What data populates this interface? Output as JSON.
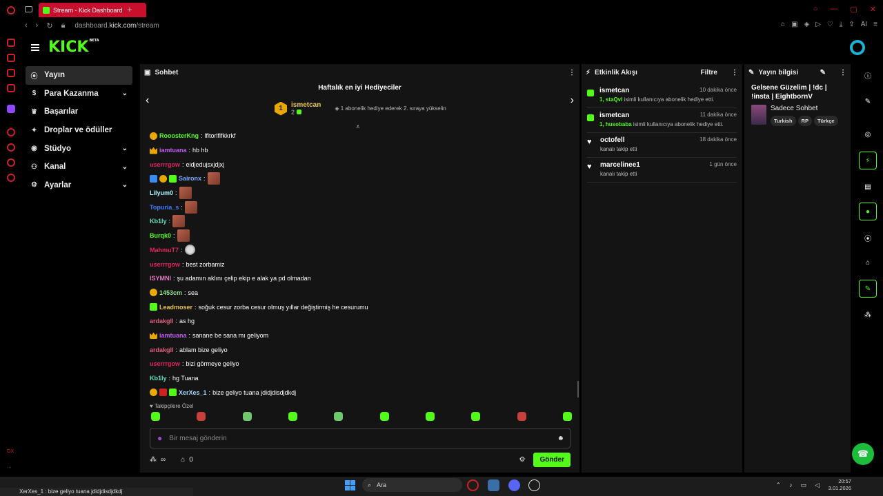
{
  "browser": {
    "tab_title": "Stream - Kick Dashboard",
    "url_prefix": "dashboard.",
    "url_host": "kick.com",
    "url_path": "/stream",
    "ai_label": "AI"
  },
  "header": {
    "logo": "KICK",
    "logo_beta": "BETA"
  },
  "nav": {
    "items": [
      {
        "label": "Yayın",
        "icon": "broadcast-icon"
      },
      {
        "label": "Para Kazanma",
        "icon": "dollar-icon"
      },
      {
        "label": "Başarılar",
        "icon": "trophy-icon"
      },
      {
        "label": "Droplar ve ödüller",
        "icon": "gift-icon"
      },
      {
        "label": "Stüdyo",
        "icon": "studio-icon"
      },
      {
        "label": "Kanal",
        "icon": "people-icon"
      },
      {
        "label": "Ayarlar",
        "icon": "gear-icon"
      }
    ],
    "gx": "GX",
    "more": "..."
  },
  "chat": {
    "title": "Sohbet",
    "gifters_title": "Haftalık en iyi Hediyeciler",
    "top_gifter": {
      "rank": "1",
      "name": "ismetcan",
      "count": "2"
    },
    "gifter_info": "1 abonelik hediye ederek 2. sıraya yükselin",
    "messages": [
      {
        "user": "RooosterKng",
        "text": "lfltorlflfkkrkf",
        "color": "#53fc18",
        "badges": [
          "bo"
        ]
      },
      {
        "user": "iamtuana",
        "text": "hb hb",
        "color": "#c05cf0",
        "badges": [
          "bc"
        ]
      },
      {
        "user": "userrrgow",
        "text": "eidjedujsxjdjxj",
        "color": "#e0245e",
        "badges": []
      },
      {
        "user": "Saironx",
        "text": "",
        "color": "#7aa8ff",
        "badges": [
          "bb",
          "bo",
          "bg"
        ],
        "emote": true
      },
      {
        "user": "Lilyum0",
        "text": "",
        "color": "#a7f3ff",
        "badges": [],
        "emote": true
      },
      {
        "user": "Topuria_s",
        "text": "",
        "color": "#3b7cff",
        "badges": [],
        "emote": true
      },
      {
        "user": "Kb1ly",
        "text": "",
        "color": "#5fe0c0",
        "badges": [],
        "emote": true
      },
      {
        "user": "Burqk0",
        "text": "",
        "color": "#53fc18",
        "badges": [],
        "emote": true
      },
      {
        "user": "MahmuT7",
        "text": "",
        "color": "#e0245e",
        "badges": [],
        "emote2": true
      },
      {
        "user": "userrrgow",
        "text": "best zorbamiz",
        "color": "#e0245e",
        "badges": []
      },
      {
        "user": "lSYMNl",
        "text": "şu adamın aklını çelip ekip e alak ya pd olmadan",
        "color": "#e879c8",
        "badges": []
      },
      {
        "user": "1453cm",
        "text": "sea",
        "color": "#8fe08f",
        "badges": [
          "bo"
        ]
      },
      {
        "user": "Leadmoser",
        "text": "soğuk cesur zorba cesur olmuş yıllar değiştirmiş he cesurumu",
        "color": "#e8c44a",
        "badges": [
          "bg"
        ]
      },
      {
        "user": "ardakgll",
        "text": "as hg",
        "color": "#e06080",
        "badges": []
      },
      {
        "user": "iamtuana",
        "text": "sanane be sana mı geliyom",
        "color": "#c05cf0",
        "badges": [
          "bc"
        ]
      },
      {
        "user": "ardakgll",
        "text": "ablam bize geliyo",
        "color": "#e06080",
        "badges": []
      },
      {
        "user": "userrrgow",
        "text": "bizi görmeye geliyo",
        "color": "#e0245e",
        "badges": []
      },
      {
        "user": "Kb1ly",
        "text": "hg Tuana",
        "color": "#5fe0c0",
        "badges": []
      },
      {
        "user": "XerXes_1",
        "text": "bize geliyo tuana jdidjdisdjdkdj",
        "color": "#a7d8ff",
        "badges": [
          "bo",
          "br",
          "bg"
        ]
      }
    ],
    "followers_label": "Takipçilere Özel",
    "input_placeholder": "Bir mesaj gönderin",
    "infinity": "∞",
    "zero": "0",
    "send_label": "Gönder"
  },
  "activity": {
    "title": "Etkinlik Akışı",
    "filter": "Filtre",
    "items": [
      {
        "type": "gift",
        "name": "ismetcan",
        "time": "10 dakika önce",
        "highlight": "1, staQvl",
        "text": " isimli kullanıcıya abonelik hediye etti."
      },
      {
        "type": "gift",
        "name": "ismetcan",
        "time": "11 dakika önce",
        "highlight": "1, husobaba",
        "text": " isimli kullanıcıya abonelik hediye etti."
      },
      {
        "type": "follow",
        "name": "octofell",
        "time": "18 dakika önce",
        "highlight": "",
        "text": "kanalı takip etti"
      },
      {
        "type": "follow",
        "name": "marcelinee1",
        "time": "1 gün önce",
        "highlight": "",
        "text": "kanalı takip etti"
      }
    ]
  },
  "info": {
    "title": "Yayın bilgisi",
    "stream_title": "Gelsene Güzelim | !dc | !insta | EightbornV",
    "category": "Sadece Sohbet",
    "tags": [
      "Turkish",
      "RP",
      "Türkçe"
    ]
  },
  "taskbar": {
    "status_text": "XerXes_1 : bize geliyo tuana jdidjdisdjdkdj",
    "search": "Ara",
    "time": "20:57",
    "date": "3.01.2026"
  }
}
